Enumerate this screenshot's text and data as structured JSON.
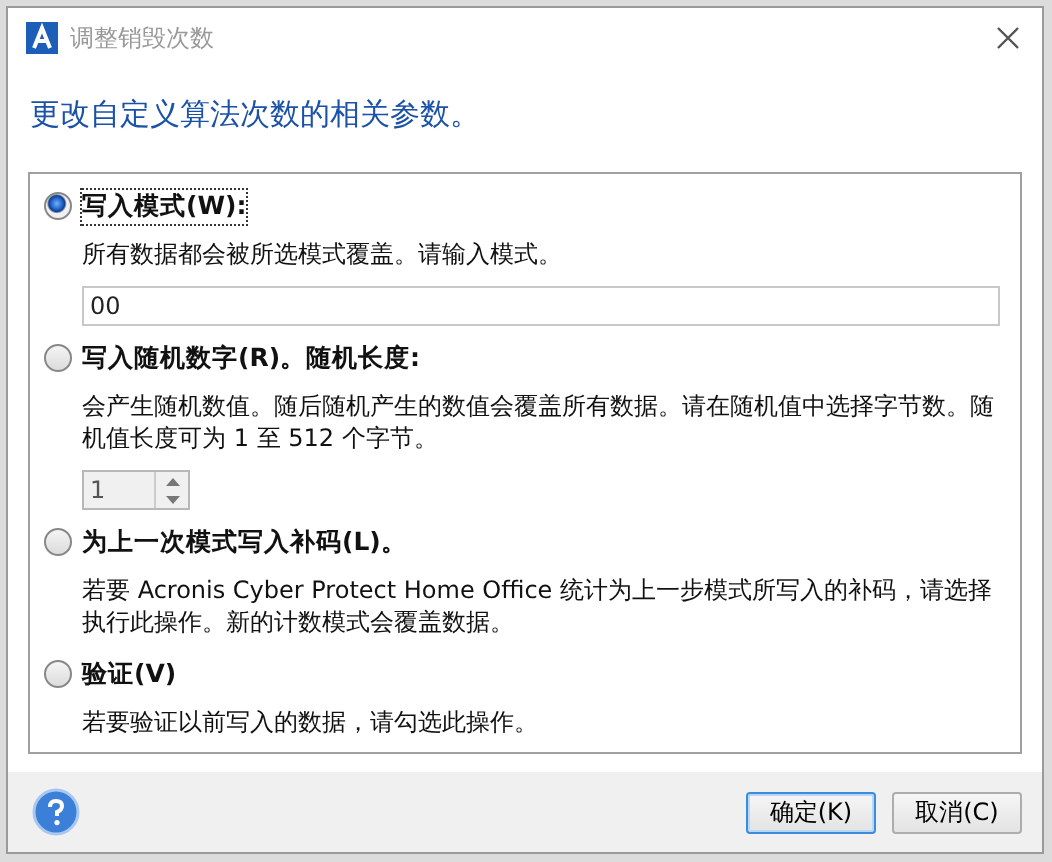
{
  "window": {
    "title": "调整销毁次数"
  },
  "heading": "更改自定义算法次数的相关参数。",
  "options": [
    {
      "label": "写入模式(W):",
      "selected": true,
      "description": "所有数据都会被所选模式覆盖。请输入模式。",
      "control": {
        "kind": "text",
        "value": "00"
      }
    },
    {
      "label": "写入随机数字(R)。随机长度:",
      "selected": false,
      "description": "会产生随机数值。随后随机产生的数值会覆盖所有数据。请在随机值中选择字节数。随机值长度可为 1 至 512 个字节。",
      "control": {
        "kind": "spin",
        "value": "1"
      }
    },
    {
      "label": "为上一次模式写入补码(L)。",
      "selected": false,
      "description": "若要 Acronis Cyber Protect Home Office 统计为上一步模式所写入的补码，请选择执行此操作。新的计数模式会覆盖数据。"
    },
    {
      "label": "验证(V)",
      "selected": false,
      "description": "若要验证以前写入的数据，请勾选此操作。"
    }
  ],
  "buttons": [
    {
      "label": "确定(K)",
      "kind": "default"
    },
    {
      "label": "取消(C)",
      "kind": "normal"
    }
  ]
}
